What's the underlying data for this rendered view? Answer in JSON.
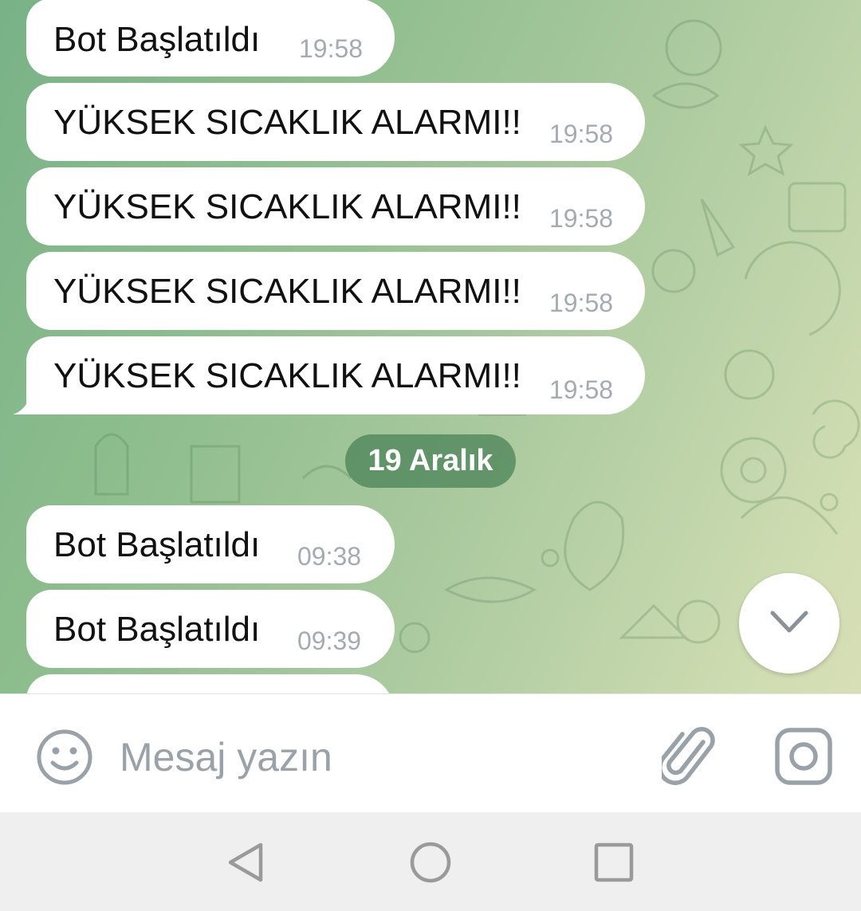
{
  "messages": [
    {
      "text": "Bot Başlatıldı",
      "time": "19:58"
    },
    {
      "text": "YÜKSEK SICAKLIK ALARMI!!",
      "time": "19:58"
    },
    {
      "text": "YÜKSEK SICAKLIK ALARMI!!",
      "time": "19:58"
    },
    {
      "text": "YÜKSEK SICAKLIK ALARMI!!",
      "time": "19:58"
    },
    {
      "text": "YÜKSEK SICAKLIK ALARMI!!",
      "time": "19:58"
    }
  ],
  "date_separator": "19 Aralık",
  "messages_day2": [
    {
      "text": "Bot Başlatıldı",
      "time": "09:38"
    },
    {
      "text": "Bot Başlatıldı",
      "time": "09:39"
    }
  ],
  "composer": {
    "placeholder": "Mesaj yazın",
    "emoji_icon": "emoji-smile-icon",
    "attach_icon": "paperclip-icon",
    "camera_icon": "instagram-camera-icon"
  },
  "scroll_button_icon": "chevron-down-icon",
  "nav": {
    "back_icon": "back-triangle-icon",
    "home_icon": "home-circle-icon",
    "recents_icon": "recents-square-icon"
  },
  "colors": {
    "bubble": "#ffffff",
    "time_text": "#a4abb1",
    "date_pill": "#4f8a5c",
    "placeholder": "#9aa2a9",
    "icon_gray": "#9aa2a9",
    "nav_bg": "#efefef"
  }
}
